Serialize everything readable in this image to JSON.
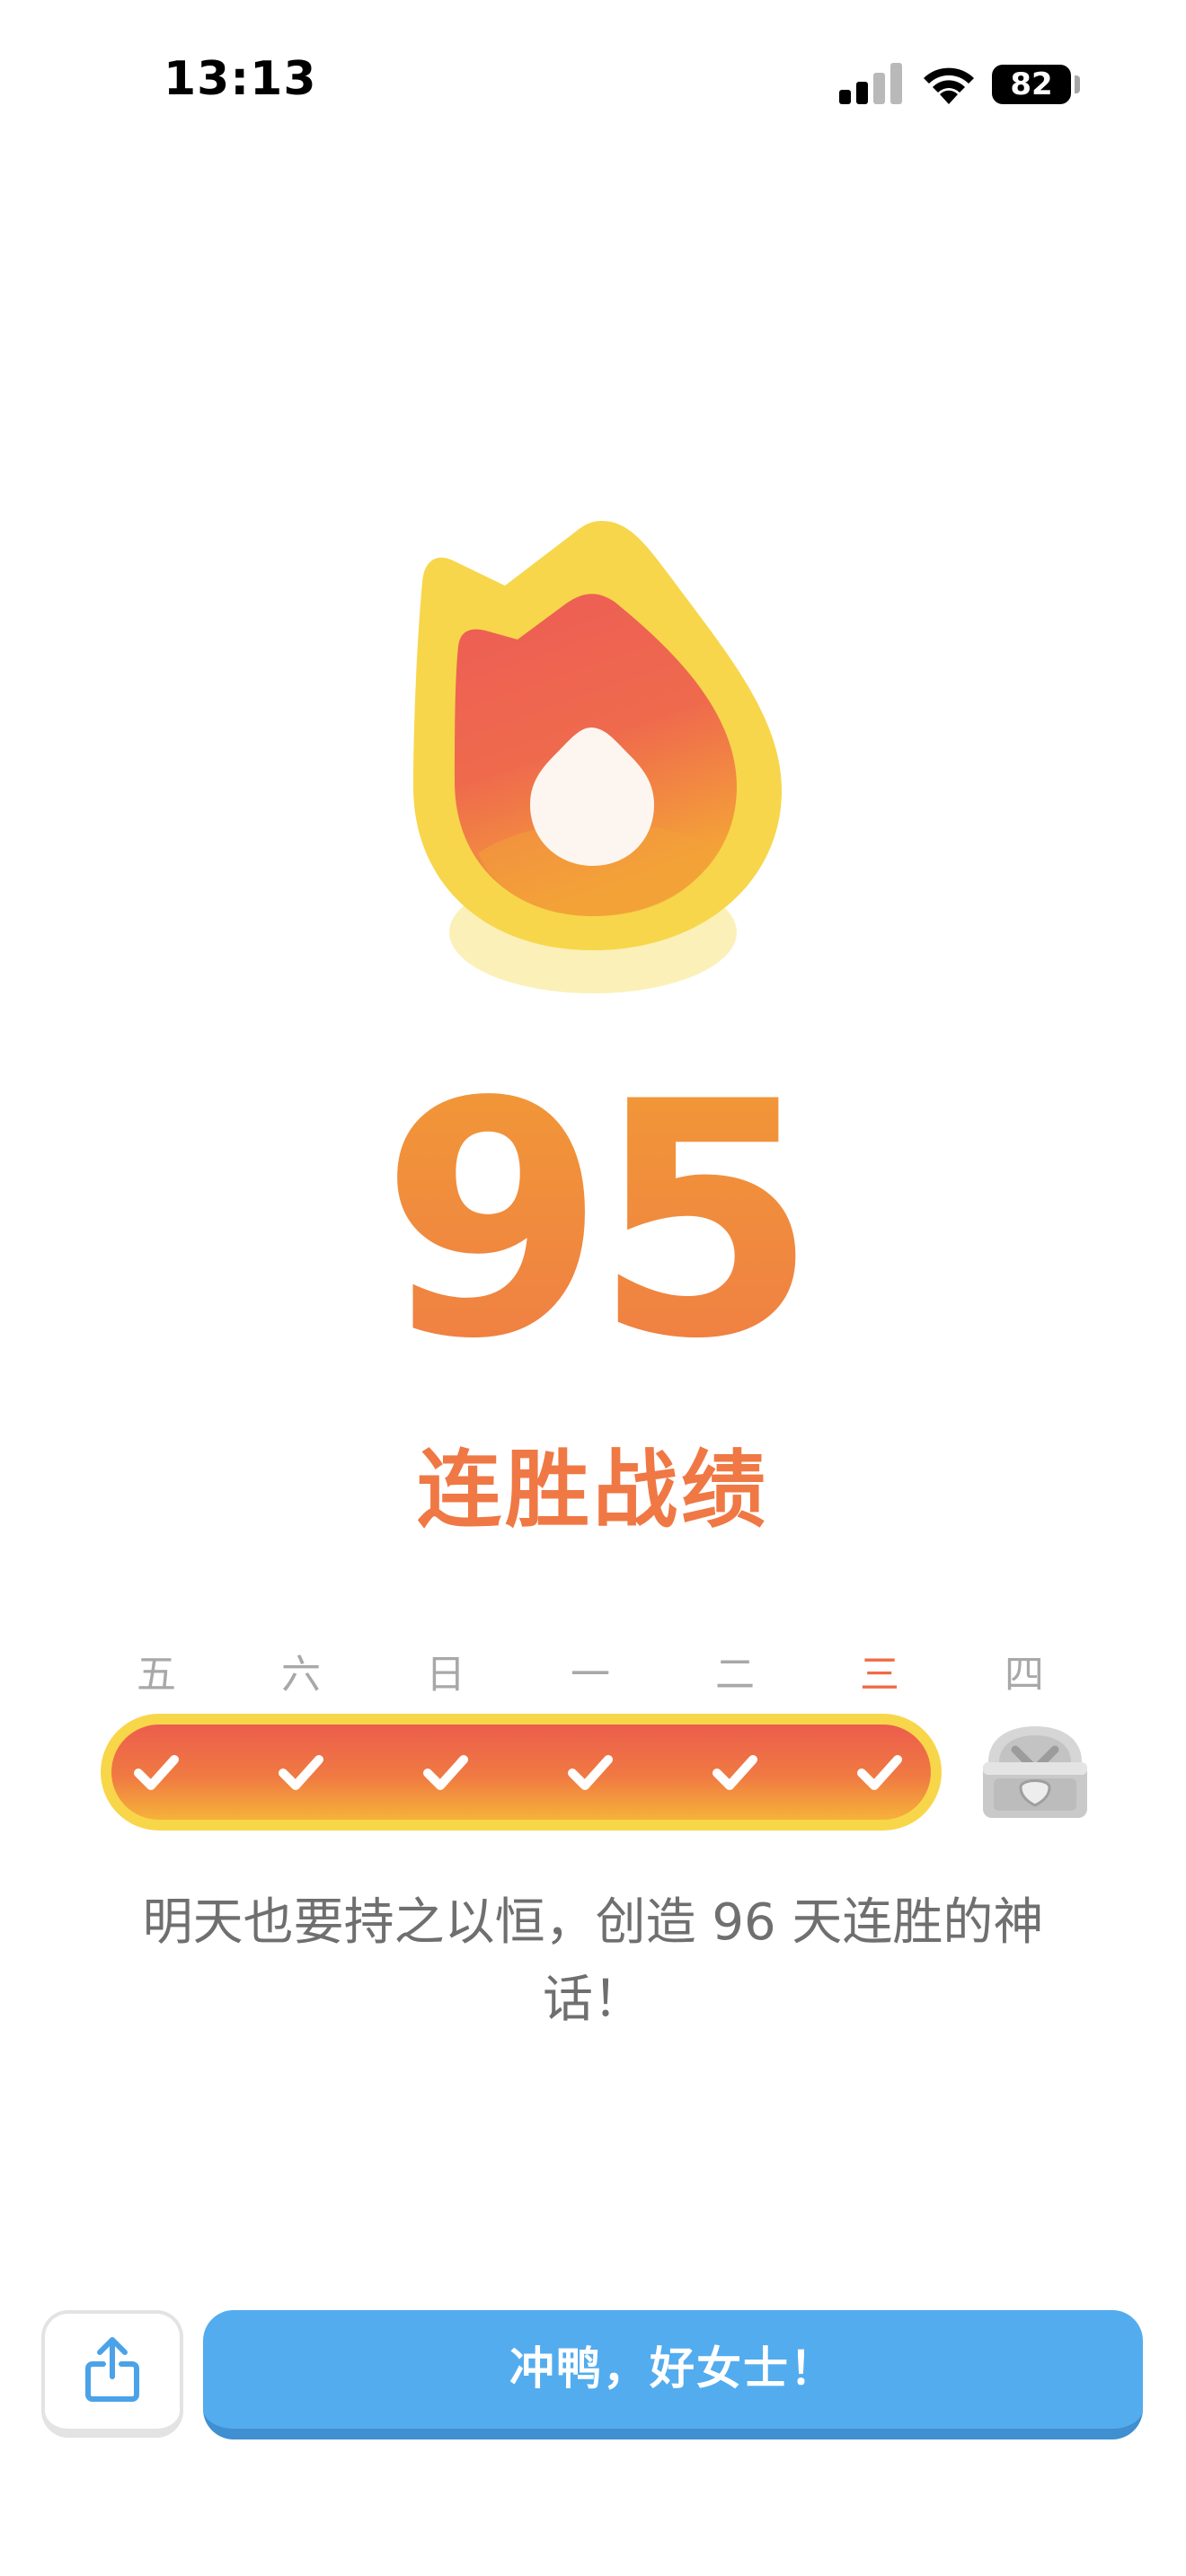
{
  "status_bar": {
    "time": "13:13",
    "battery": "82"
  },
  "streak": {
    "count": "95",
    "label": "连胜战绩"
  },
  "week": {
    "days": [
      {
        "label": "五",
        "completed": true
      },
      {
        "label": "六",
        "completed": true
      },
      {
        "label": "日",
        "completed": true
      },
      {
        "label": "一",
        "completed": true
      },
      {
        "label": "二",
        "completed": true
      },
      {
        "label": "三",
        "completed": true,
        "today": true
      },
      {
        "label": "四",
        "completed": false,
        "reward": "treasure-chest"
      }
    ]
  },
  "message": "明天也要持之以恒，创造 96 天连胜的神话！",
  "actions": {
    "share_icon": "share-icon",
    "primary_label": "冲鸭，好女士！"
  },
  "colors": {
    "streak_orange": "#ef7845",
    "today_day": "#ef6c46",
    "bar_border": "#f8d64a",
    "primary_button": "#53acee",
    "text_gray": "#6f6f6f"
  }
}
